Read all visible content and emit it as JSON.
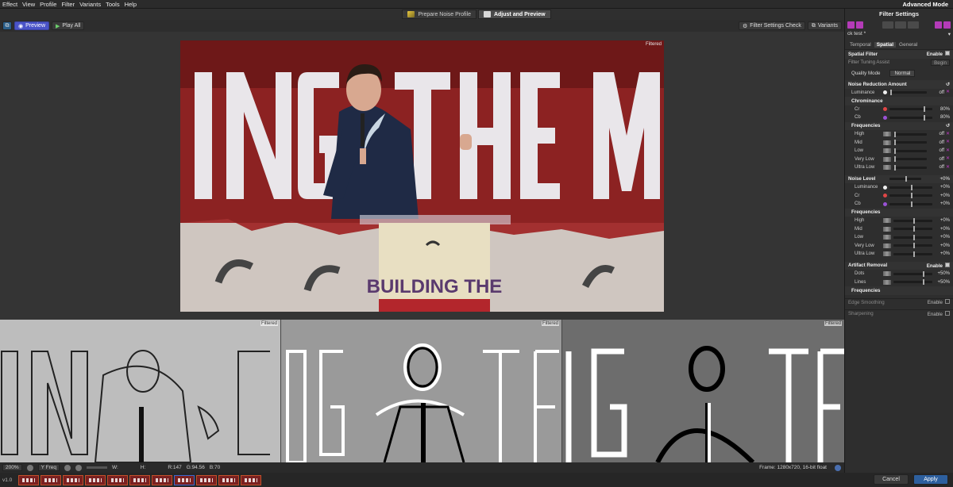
{
  "menubar": {
    "items": [
      "Effect",
      "View",
      "Profile",
      "Filter",
      "Variants",
      "Tools",
      "Help"
    ],
    "mode": "Advanced Mode"
  },
  "tabs": [
    {
      "label": "Prepare Noise Profile",
      "active": false
    },
    {
      "label": "Adjust and Preview",
      "active": true
    }
  ],
  "toolbar": {
    "preview": "Preview",
    "play_all": "Play All",
    "filter_settings_check": "Filter Settings Check",
    "variants": "Variants"
  },
  "viewer": {
    "main_flag": "Filtered"
  },
  "thumbnails": [
    {
      "flag": "Filtered"
    },
    {
      "flag": "Filtered"
    },
    {
      "flag": "Filtered"
    }
  ],
  "statusbar": {
    "zoom": "200%",
    "channel": "Y Freq",
    "w_label": "W:",
    "h_label": "H:",
    "r": "R:147",
    "g": "G:94.56",
    "b": "B:70",
    "frame_info": "Frame: 1280x720, 16-bit float"
  },
  "filmstrip": {
    "version": "v1.0",
    "count": 11,
    "selected_index": 7
  },
  "footer": {
    "cancel": "Cancel",
    "apply": "Apply"
  },
  "panel": {
    "title": "Filter Settings",
    "preset": "ck test *",
    "tabs": [
      "Temporal",
      "Spatial",
      "General"
    ],
    "active_tab": "Spatial",
    "spatial_filter": {
      "label": "Spatial Filter",
      "enable": "Enable"
    },
    "tuning": {
      "label": "Filter Tuning Assist",
      "button": "Begin"
    },
    "quality": {
      "label": "Quality Mode",
      "value": "Normal"
    },
    "noise_reduction": {
      "title": "Noise Reduction Amount",
      "luminance": {
        "label": "Luminance",
        "value": "off"
      },
      "chrominance_title": "Chrominance",
      "cr": {
        "label": "Cr",
        "value": "80%"
      },
      "cb": {
        "label": "Cb",
        "value": "80%"
      },
      "frequencies_title": "Frequencies",
      "freq": [
        {
          "label": "High",
          "value": "off"
        },
        {
          "label": "Mid",
          "value": "off"
        },
        {
          "label": "Low",
          "value": "off"
        },
        {
          "label": "Very Low",
          "value": "off"
        },
        {
          "label": "Ultra Low",
          "value": "off"
        }
      ]
    },
    "noise_level": {
      "title": "Noise Level",
      "value": "+0%",
      "luminance": {
        "label": "Luminance",
        "value": "+0%"
      },
      "cr": {
        "label": "Cr",
        "value": "+0%"
      },
      "cb": {
        "label": "Cb",
        "value": "+0%"
      },
      "frequencies_title": "Frequencies",
      "freq": [
        {
          "label": "High",
          "value": "+0%"
        },
        {
          "label": "Mid",
          "value": "+0%"
        },
        {
          "label": "Low",
          "value": "+0%"
        },
        {
          "label": "Very Low",
          "value": "+0%"
        },
        {
          "label": "Ultra Low",
          "value": "+0%"
        }
      ]
    },
    "artifact": {
      "title": "Artifact Removal",
      "enable": "Enable",
      "dots": {
        "label": "Dots",
        "value": "+50%"
      },
      "lines": {
        "label": "Lines",
        "value": "+50%"
      },
      "frequencies": "Frequencies"
    },
    "edge": {
      "title": "Edge Smoothing",
      "enable": "Enable"
    },
    "sharpening": {
      "title": "Sharpening",
      "enable": "Enable"
    }
  },
  "colors": {
    "accent_blue": "#4a54c8",
    "apply_blue": "#2d5f9e",
    "magenta": "#b43bb8",
    "backdrop_red": "#8c2222"
  }
}
